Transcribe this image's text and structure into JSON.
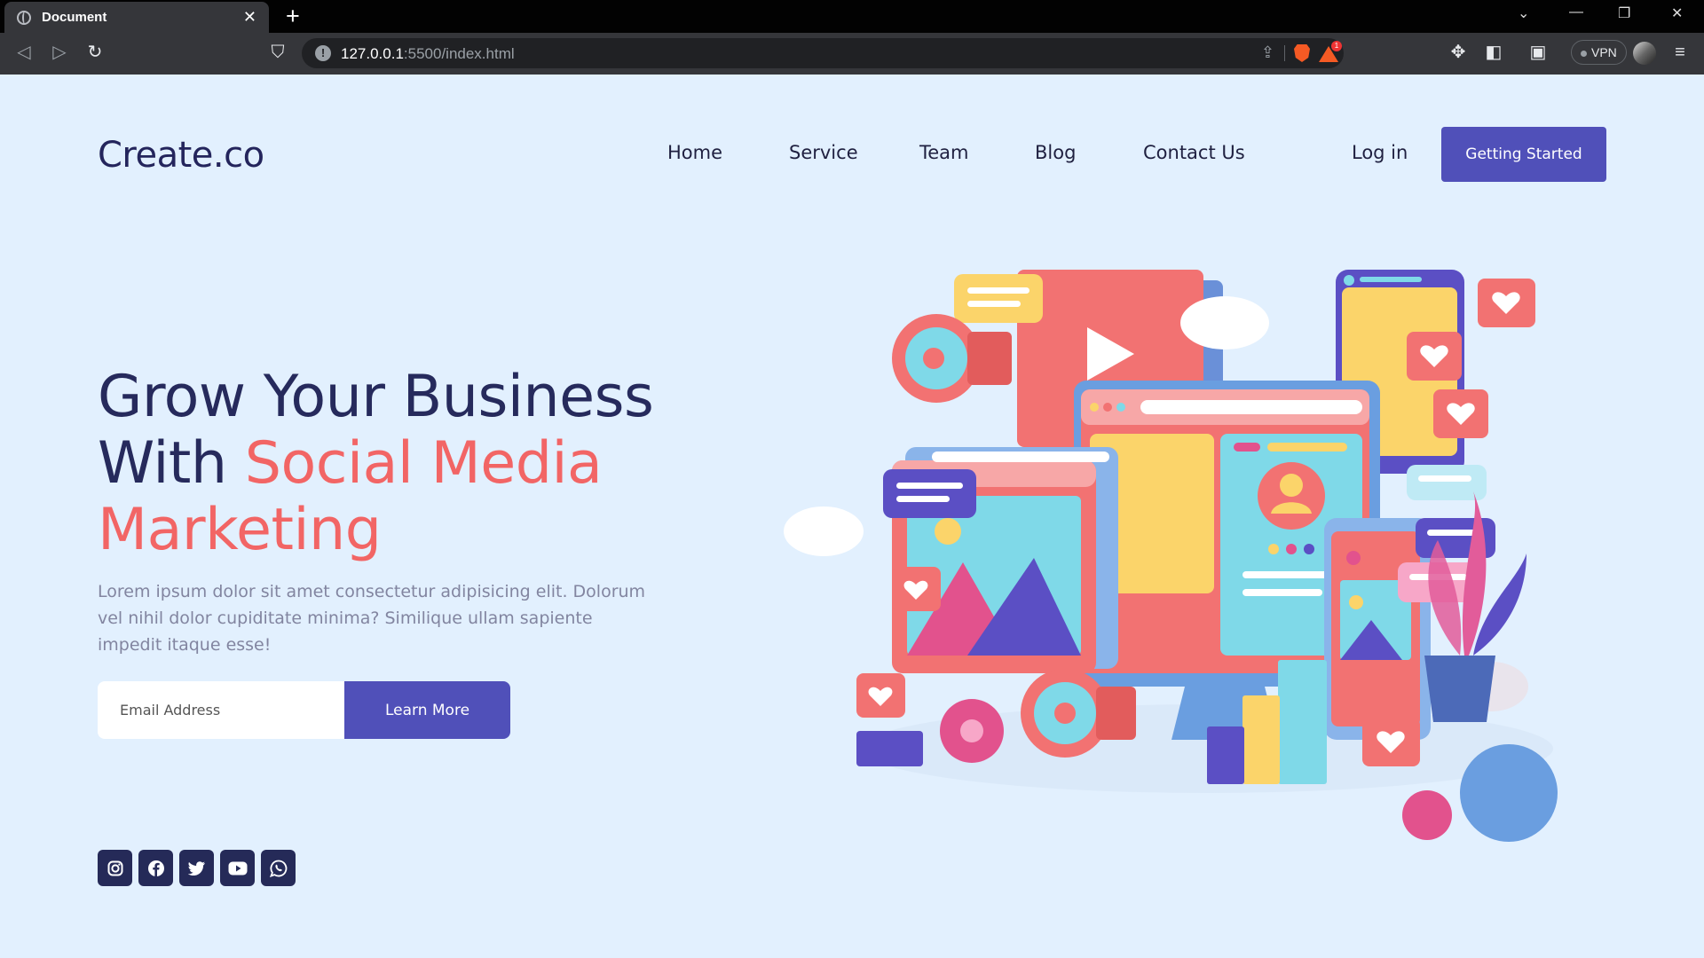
{
  "browser": {
    "tab_title": "Document",
    "new_tab": "+",
    "url_host": "127.0.0.1",
    "url_rest": ":5500/index.html",
    "vpn_label": "VPN",
    "shield_badge": "1"
  },
  "nav": {
    "logo": "Create.co",
    "links": [
      "Home",
      "Service",
      "Team",
      "Blog",
      "Contact Us"
    ],
    "login": "Log in",
    "cta": "Getting Started"
  },
  "hero": {
    "headline_line1": "Grow Your Business",
    "headline_with": "With ",
    "headline_accent1": "Social Media",
    "headline_accent2": "Marketing",
    "paragraph": "Lorem ipsum dolor sit amet consectetur adipisicing elit. Dolorum vel nihil dolor cupiditate minima? Similique ullam sapiente impedit itaque esse!",
    "email_placeholder": "Email Address",
    "button": "Learn More"
  },
  "socials": [
    "instagram-icon",
    "facebook-icon",
    "twitter-icon",
    "youtube-icon",
    "whatsapp-icon"
  ],
  "colors": {
    "page_bg": "#e2f0fe",
    "primary": "#5050b9",
    "accent": "#f26565",
    "heading": "#262a5c"
  }
}
